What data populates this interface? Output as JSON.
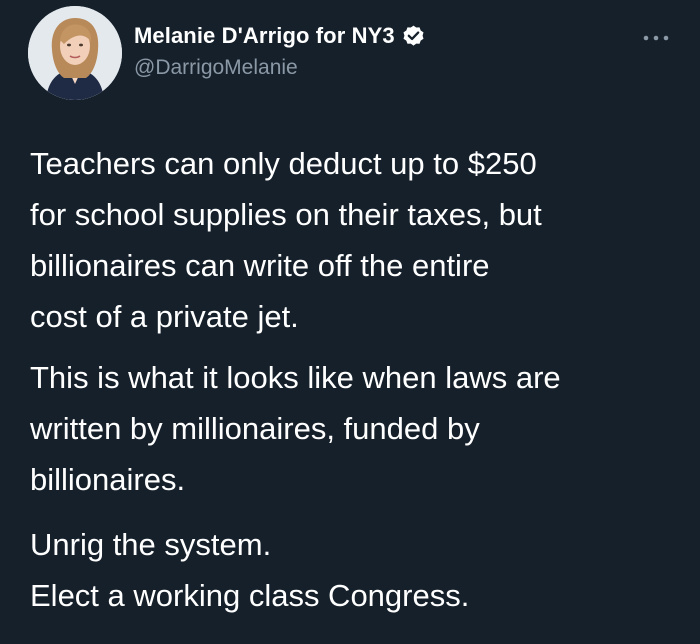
{
  "author": {
    "display_name": "Melanie D'Arrigo for NY3",
    "handle": "@DarrigoMelanie",
    "verified": true,
    "avatar_icon": "profile-photo"
  },
  "menu_icon": "more-dots-icon",
  "tweet": {
    "paragraph1": [
      "Teachers can only deduct up to $250",
      "for school supplies on their taxes, but",
      "billionaires can write off the entire",
      "cost of a private jet."
    ],
    "paragraph2": [
      "This is what it looks like when laws are",
      "written by millionaires, funded by",
      "billionaires."
    ],
    "paragraph3": [
      "Unrig the system.",
      "Elect a working class Congress."
    ]
  },
  "colors": {
    "background": "#15202b",
    "text": "#ffffff",
    "handle": "#8b98a5",
    "verified_badge": "#ffffff"
  }
}
